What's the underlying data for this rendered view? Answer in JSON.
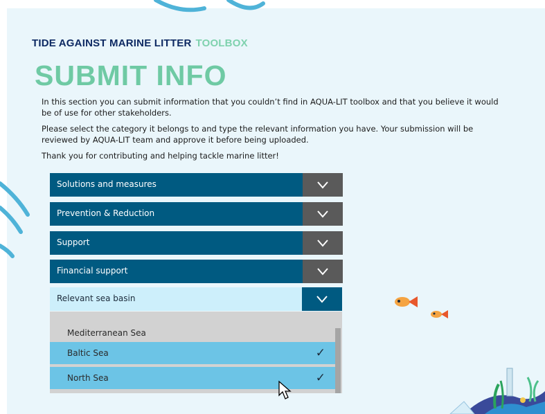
{
  "brand": {
    "name": "TIDE AGAINST MARINE LITTER",
    "tag": "TOOLBOX"
  },
  "title": "SUBMIT INFO",
  "paragraphs": [
    "In this section you can submit information that you couldn’t find in AQUA-LIT toolbox and that you believe it would be of use for other stakeholders.",
    "Please select the category it belongs to and type the relevant information you have. Your submission will be reviewed by AQUA-LIT team and approve it before being uploaded.",
    "Thank you for contributing and helping tackle marine litter!"
  ],
  "categories": [
    {
      "label": "Solutions and measures"
    },
    {
      "label": "Prevention & Reduction"
    },
    {
      "label": "Support"
    },
    {
      "label": "Financial support"
    },
    {
      "label": "Relevant sea basin"
    }
  ],
  "sea_basin_options": [
    {
      "label": "Mediterranean Sea",
      "selected": false
    },
    {
      "label": "Baltic Sea",
      "selected": true
    },
    {
      "label": "North Sea",
      "selected": true
    }
  ],
  "check_glyph": "✓",
  "icons": {
    "chevron": "chevron-down-icon",
    "check": "check-icon",
    "cursor": "mouse-pointer-icon",
    "fish": "fish-icon"
  },
  "colors": {
    "accordion_bg": "#005a81",
    "chevron_bg": "#5a5a5a",
    "title": "#6fcaa4",
    "brand": "#0e2a63",
    "selected_option": "#6cc4e6",
    "page_bg": "#eaf6fb"
  }
}
